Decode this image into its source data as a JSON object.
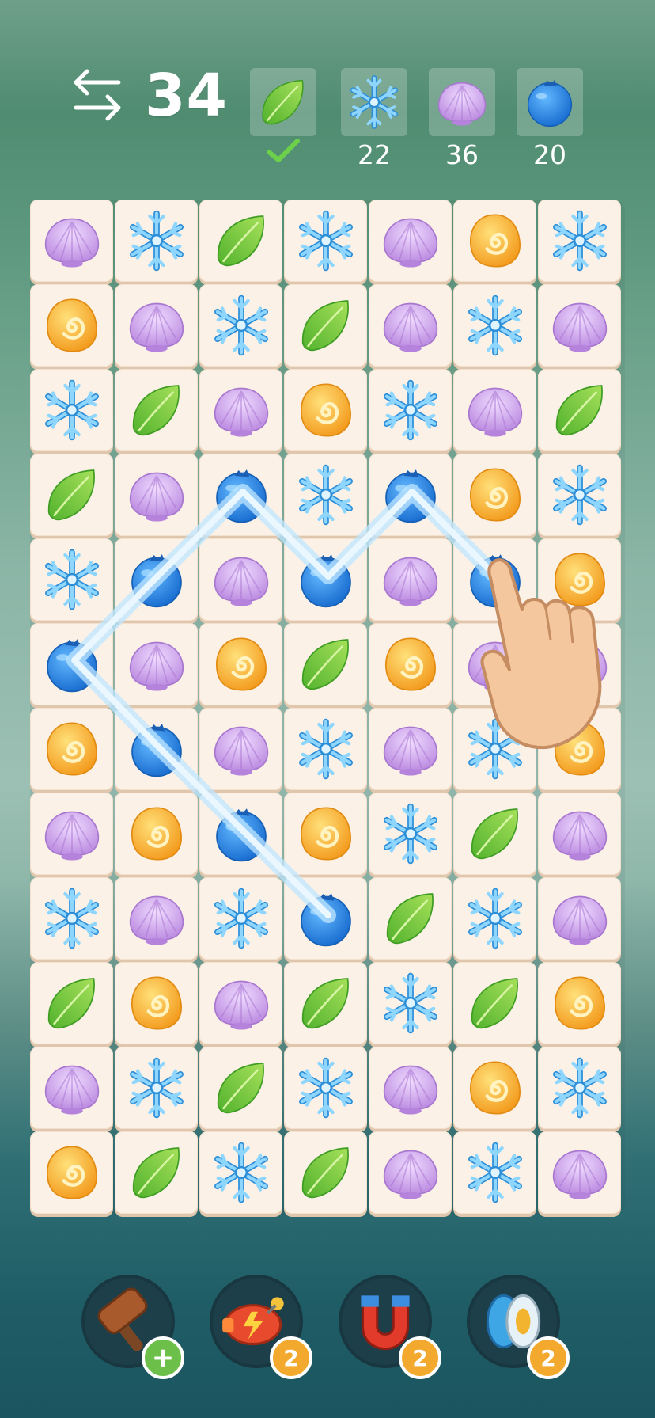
{
  "moves": "34",
  "goals": [
    {
      "icon": "leaf-icon",
      "count": "",
      "done": true
    },
    {
      "icon": "snowflake-icon",
      "count": "22",
      "done": false
    },
    {
      "icon": "shell-icon",
      "count": "36",
      "done": false
    },
    {
      "icon": "berry-icon",
      "count": "20",
      "done": false
    }
  ],
  "grid": [
    [
      "shell",
      "snow",
      "leaf",
      "snow",
      "shell",
      "snail",
      "snow"
    ],
    [
      "snail",
      "shell",
      "snow",
      "leaf",
      "shell",
      "snow",
      "shell"
    ],
    [
      "snow",
      "leaf",
      "shell",
      "snail",
      "snow",
      "shell",
      "leaf"
    ],
    [
      "leaf",
      "shell",
      "berry",
      "snow",
      "berry",
      "snail",
      "snow"
    ],
    [
      "snow",
      "berry",
      "shell",
      "berry",
      "shell",
      "berry",
      "snail"
    ],
    [
      "berry",
      "shell",
      "snail",
      "leaf",
      "snail",
      "shell",
      "shell"
    ],
    [
      "snail",
      "berry",
      "shell",
      "snow",
      "shell",
      "snow",
      "snail"
    ],
    [
      "shell",
      "snail",
      "berry",
      "snail",
      "snow",
      "leaf",
      "shell"
    ],
    [
      "snow",
      "shell",
      "snow",
      "berry",
      "leaf",
      "snow",
      "shell"
    ],
    [
      "leaf",
      "snail",
      "shell",
      "leaf",
      "snow",
      "leaf",
      "snail"
    ],
    [
      "shell",
      "snow",
      "leaf",
      "snow",
      "shell",
      "snail",
      "snow"
    ],
    [
      "snail",
      "leaf",
      "snow",
      "leaf",
      "shell",
      "snow",
      "shell"
    ]
  ],
  "boosters": [
    {
      "icon": "hammer-icon",
      "badge": "+"
    },
    {
      "icon": "blaster-icon",
      "badge": "2"
    },
    {
      "icon": "magnet-icon",
      "badge": "2"
    },
    {
      "icon": "yoyo-icon",
      "badge": "2"
    }
  ],
  "colors": {
    "tile": "#fbf1e6",
    "shell": "#c99be8",
    "snow": "#5ab5ec",
    "leaf": "#6cc43b",
    "snail": "#f7b52b",
    "berry": "#2f8ae3",
    "link": "#bfe6ff"
  }
}
